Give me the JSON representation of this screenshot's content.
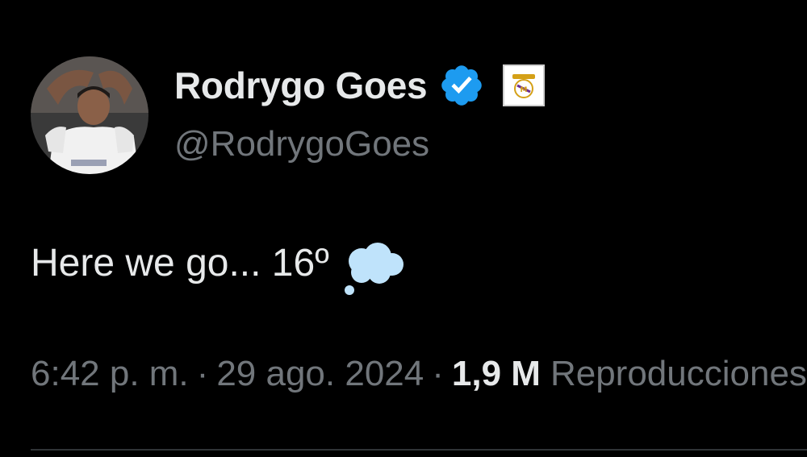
{
  "author": {
    "display_name": "Rodrygo Goes",
    "handle": "@RodrygoGoes",
    "avatar_icon": "player-avatar",
    "verified_icon": "verified-badge-icon",
    "affiliate_icon": "real-madrid-crest-icon"
  },
  "tweet": {
    "text": "Here we go... 16º",
    "emoji_icon": "thought-balloon-icon"
  },
  "meta": {
    "time": "6:42 p. m.",
    "separator": "·",
    "date": "29 ago. 2024",
    "views_count": "1,9 M",
    "views_label": "Reproducciones"
  },
  "colors": {
    "background": "#000000",
    "primary_text": "#e7e9ea",
    "secondary_text": "#71767b",
    "verified_blue": "#1d9bf0",
    "divider": "#2f3336"
  }
}
